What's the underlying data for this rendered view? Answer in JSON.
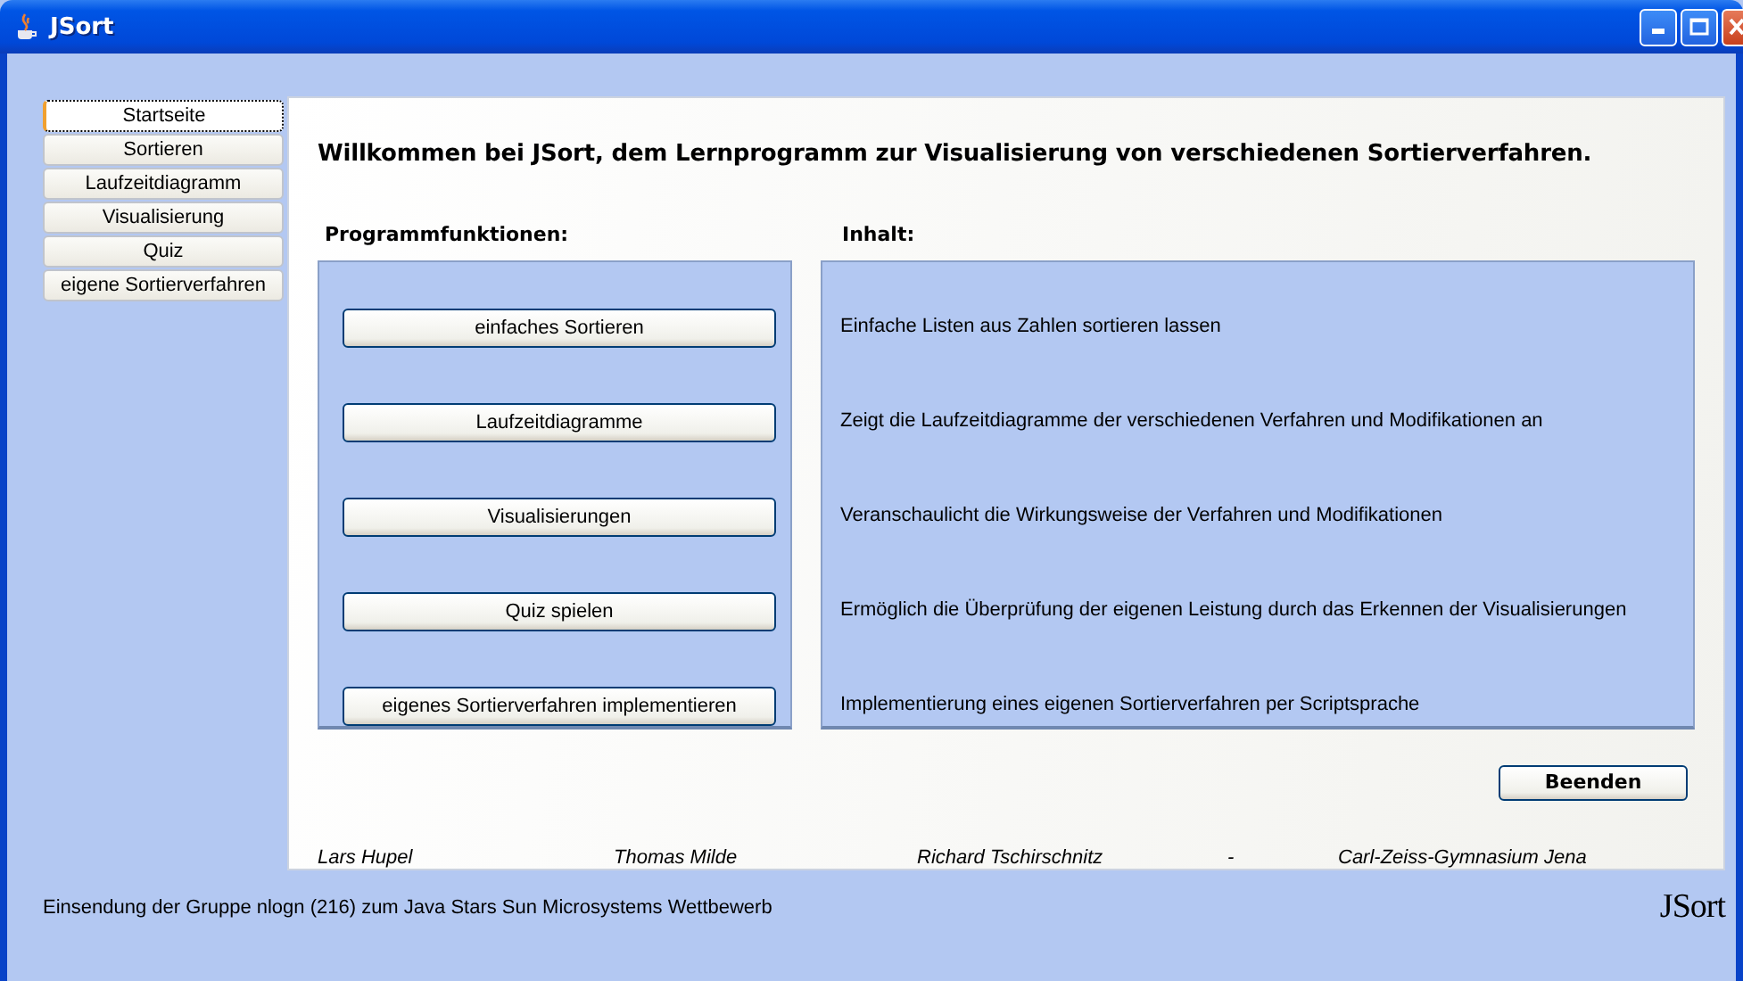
{
  "window": {
    "title": "JSort"
  },
  "sidebar": {
    "tabs": [
      {
        "label": "Startseite",
        "selected": true
      },
      {
        "label": "Sortieren",
        "selected": false
      },
      {
        "label": "Laufzeitdiagramm",
        "selected": false
      },
      {
        "label": "Visualisierung",
        "selected": false
      },
      {
        "label": "Quiz",
        "selected": false
      },
      {
        "label": "eigene Sortierverfahren",
        "selected": false
      }
    ]
  },
  "heading": "Willkommen bei JSort, dem Lernprogramm zur Visualisierung von verschiedenen Sortierverfahren.",
  "functions_label": "Programmfunktionen:",
  "content_label": "Inhalt:",
  "rows": [
    {
      "button": "einfaches Sortieren",
      "description": "Einfache Listen aus Zahlen sortieren lassen"
    },
    {
      "button": "Laufzeitdiagramme",
      "description": "Zeigt die Laufzeitdiagramme der verschiedenen Verfahren und Modifikationen an"
    },
    {
      "button": "Visualisierungen",
      "description": "Veranschaulicht die Wirkungsweise der Verfahren und Modifikationen"
    },
    {
      "button": "Quiz spielen",
      "description": "Ermöglich die Überprüfung der eigenen Leistung durch das Erkennen der Visualisierungen"
    },
    {
      "button": "eigenes Sortierverfahren implementieren",
      "description": "Implementierung eines eigenen Sortierverfahren per Scriptsprache"
    }
  ],
  "quit_button": "Beenden",
  "credits": [
    "Lars Hupel",
    "Thomas Milde",
    "Richard Tschirschnitz",
    "-",
    "Carl-Zeiss-Gymnasium Jena"
  ],
  "status_text": "Einsendung der Gruppe nlogn (216) zum Java Stars Sun Microsystems Wettbewerb",
  "logo": "JSort"
}
